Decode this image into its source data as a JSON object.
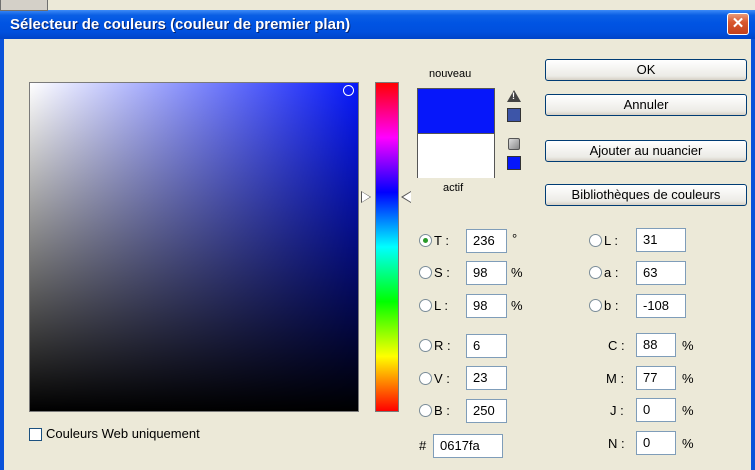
{
  "window": {
    "title": "Sélecteur de couleurs (couleur de premier plan)",
    "close_glyph": "✕"
  },
  "swatch": {
    "new_label": "nouveau",
    "current_label": "actif",
    "new_color": "#0617fa",
    "current_color": "#ffffff"
  },
  "icons": {
    "warning": "!",
    "cube": "cube"
  },
  "buttons": {
    "ok": "OK",
    "cancel": "Annuler",
    "add_swatch": "Ajouter au nuancier",
    "libraries": "Bibliothèques de couleurs"
  },
  "hsb": {
    "h": {
      "label": "T :",
      "value": "236",
      "unit": "°",
      "selected": true
    },
    "s": {
      "label": "S :",
      "value": "98",
      "unit": "%"
    },
    "b": {
      "label": "L :",
      "value": "98",
      "unit": "%"
    }
  },
  "rgb": {
    "r": {
      "label": "R :",
      "value": "6"
    },
    "g": {
      "label": "V :",
      "value": "23"
    },
    "b": {
      "label": "B :",
      "value": "250"
    }
  },
  "hex": {
    "label": "#",
    "value": "0617fa"
  },
  "lab": {
    "l": {
      "label": "L :",
      "value": "31"
    },
    "a": {
      "label": "a :",
      "value": "63"
    },
    "b": {
      "label": "b :",
      "value": "-108"
    }
  },
  "cmyk": {
    "c": {
      "label": "C :",
      "value": "88",
      "unit": "%"
    },
    "m": {
      "label": "M :",
      "value": "77",
      "unit": "%"
    },
    "y": {
      "label": "J :",
      "value": "0",
      "unit": "%"
    },
    "k": {
      "label": "N :",
      "value": "0",
      "unit": "%"
    }
  },
  "web_only": {
    "label": "Couleurs Web uniquement",
    "checked": false
  }
}
